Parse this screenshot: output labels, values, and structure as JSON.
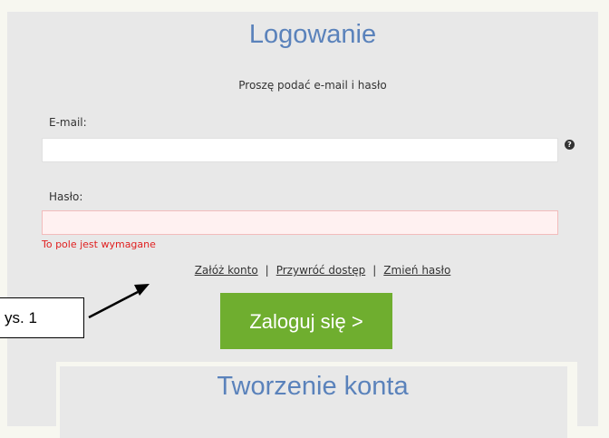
{
  "login": {
    "title": "Logowanie",
    "subtitle": "Proszę podać e-mail i hasło",
    "email_label": "E-mail:",
    "email_value": "",
    "help_icon": "question-icon",
    "password_label": "Hasło:",
    "password_value": "",
    "password_error": "To pole jest wymagane",
    "error_color": "#e02020",
    "links": {
      "create_account": "Załóż konto",
      "separator": "|",
      "restore_access": "Przywróć dostęp",
      "change_password": "Zmień hasło"
    },
    "submit_label": "Zaloguj się >",
    "submit_color": "#6fae2f",
    "title_color": "#5a82bb"
  },
  "register": {
    "title": "Tworzenie konta"
  },
  "annotation": {
    "label": "ys. 1"
  }
}
